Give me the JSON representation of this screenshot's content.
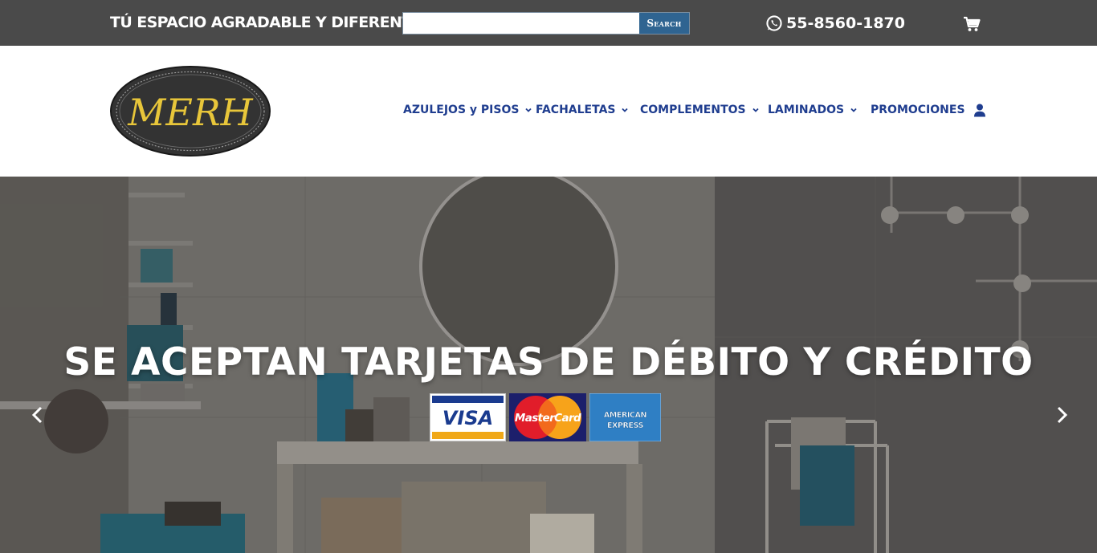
{
  "topbar": {
    "tagline": "TÚ ESPACIO AGRADABLE Y DIFERENTE",
    "search_placeholder": "",
    "search_button": "Search",
    "phone": "55-8560-1870",
    "phone_icon": "whatsapp-icon",
    "cart_icon": "shopping-cart-icon",
    "background": "#4a4a4a"
  },
  "header": {
    "logo_text": "MERH",
    "nav": [
      {
        "label": "AZULEJOS y PISOS",
        "has_dropdown": true
      },
      {
        "label": "FACHALETAS",
        "has_dropdown": true
      },
      {
        "label": "COMPLEMENTOS",
        "has_dropdown": true
      },
      {
        "label": "LAMINADOS",
        "has_dropdown": true
      },
      {
        "label": "PROMOCIONES",
        "has_dropdown": false
      }
    ],
    "account_icon": "user-icon",
    "nav_color": "#1f3d8f"
  },
  "hero": {
    "title": "SE ACEPTAN TARJETAS DE DÉBITO Y CRÉDITO",
    "cards": [
      {
        "name": "VISA",
        "icon": "visa-card-icon"
      },
      {
        "name": "MasterCard",
        "icon": "mastercard-icon"
      },
      {
        "name": "AMERICAN EXPRESS",
        "icon": "amex-card-icon"
      }
    ],
    "prev_icon": "chevron-left-icon",
    "next_icon": "chevron-right-icon"
  }
}
